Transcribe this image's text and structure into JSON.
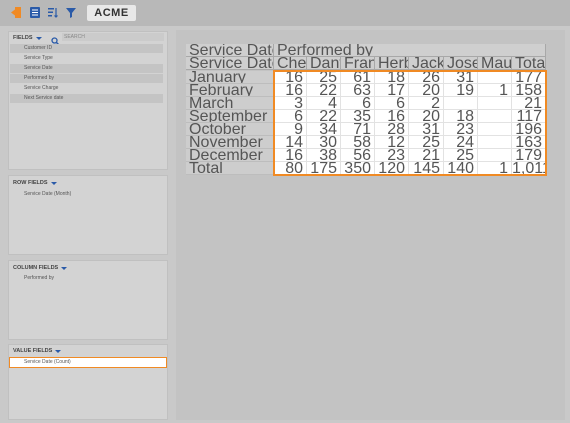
{
  "app": {
    "brand": "ACME",
    "toolbar": [
      {
        "name": "export-icon",
        "color": "#f08a24"
      },
      {
        "name": "grid-icon",
        "color": "#2a5aa8"
      },
      {
        "name": "sort-icon",
        "color": "#2a5aa8"
      },
      {
        "name": "filter-icon",
        "color": "#2a5aa8"
      }
    ]
  },
  "fields_panel": {
    "title": "FIELDS",
    "search_placeholder": "SEARCH",
    "items": [
      "Customer ID",
      "Service Type",
      "Service Date",
      "Performed by",
      "Service Charge",
      "Next Service date"
    ]
  },
  "row_fields_panel": {
    "title": "ROW FIELDS",
    "items": [
      "Service Date (Month)"
    ]
  },
  "column_fields_panel": {
    "title": "COLUMN FIELDS",
    "items": [
      "Performed by"
    ]
  },
  "value_fields_panel": {
    "title": "VALUE FIELDS",
    "items": [
      "Service Date (Count)"
    ]
  },
  "pivot": {
    "value_header": "Service Date (Count)",
    "column_header": "Performed by",
    "row_header": "Service Date (Month)",
    "columns": [
      "Cheris...",
      "Danvel...",
      "Frank...",
      "Herbe...",
      "Jacks...",
      "Jose ...",
      "Mauve",
      "Total"
    ],
    "rows": [
      {
        "label": "January",
        "values": [
          "16",
          "25",
          "61",
          "18",
          "26",
          "31",
          "",
          "177"
        ]
      },
      {
        "label": "February",
        "values": [
          "16",
          "22",
          "63",
          "17",
          "20",
          "19",
          "1",
          "158"
        ]
      },
      {
        "label": "March",
        "values": [
          "3",
          "4",
          "6",
          "6",
          "2",
          "",
          "",
          "21"
        ]
      },
      {
        "label": "September",
        "values": [
          "6",
          "22",
          "35",
          "16",
          "20",
          "18",
          "",
          "117"
        ]
      },
      {
        "label": "October",
        "values": [
          "9",
          "34",
          "71",
          "28",
          "31",
          "23",
          "",
          "196"
        ]
      },
      {
        "label": "November",
        "values": [
          "14",
          "30",
          "58",
          "12",
          "25",
          "24",
          "",
          "163"
        ]
      },
      {
        "label": "December",
        "values": [
          "16",
          "38",
          "56",
          "23",
          "21",
          "25",
          "",
          "179"
        ]
      },
      {
        "label": "Total",
        "values": [
          "80",
          "175",
          "350",
          "120",
          "145",
          "140",
          "1",
          "1,011"
        ]
      }
    ]
  }
}
